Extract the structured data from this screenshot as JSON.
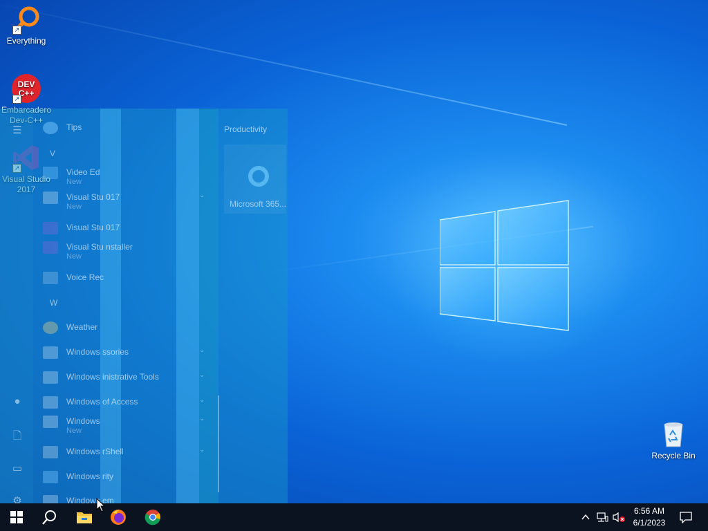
{
  "desktop": {
    "icons": [
      {
        "label": "Everything"
      },
      {
        "label": "Embarcadero Dev-C++",
        "glyph": "DEV C++"
      },
      {
        "label": "Visual Studio 2017"
      },
      {
        "label": "Recycle Bin"
      }
    ]
  },
  "start_menu": {
    "items": [
      {
        "label": "Tips"
      },
      {
        "letter": "V"
      },
      {
        "label": "Video Ed",
        "sub": "New"
      },
      {
        "label": "Visual Stu      017",
        "sub": "New"
      },
      {
        "label": "Visual Stu      017"
      },
      {
        "label": "Visual Stu      nstaller",
        "sub": "New"
      },
      {
        "label": "Voice Rec"
      },
      {
        "letter": "W"
      },
      {
        "label": "Weather"
      },
      {
        "label": "Windows      ssories"
      },
      {
        "label": "Windows      inistrative Tools"
      },
      {
        "label": "Windows      of Access"
      },
      {
        "label": "Windows",
        "sub": "New"
      },
      {
        "label": "Windows      rShell"
      },
      {
        "label": "Windows      rity"
      },
      {
        "label": "Windows      em"
      }
    ],
    "tiles_header": "Productivity",
    "tile_label": "Microsoft 365..."
  },
  "taskbar": {
    "start_icon": "windows-start-icon",
    "search_icon": "search-icon",
    "pinned": [
      "file-explorer-icon",
      "firefox-icon",
      "chrome-icon"
    ],
    "tray": {
      "chevron": "^",
      "time": "6:56 AM",
      "date": "6/1/2023"
    }
  },
  "colors": {
    "taskbar": "#0b1320",
    "wallpaper_accent": "#1c8cf0",
    "logo": "#8fd8ff"
  }
}
